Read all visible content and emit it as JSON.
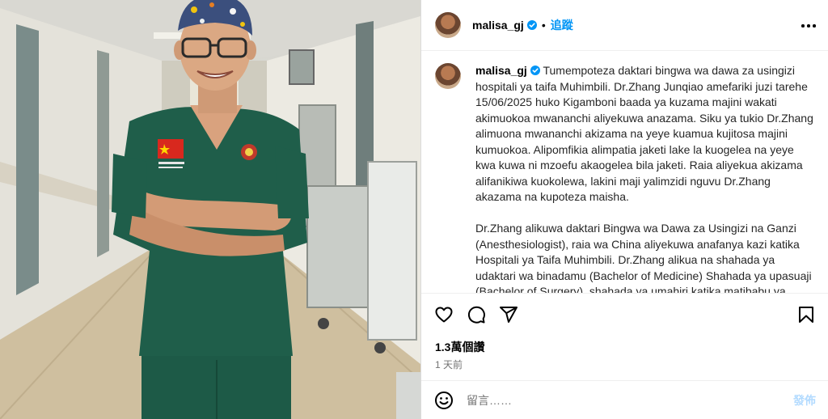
{
  "post": {
    "username": "malisa_gj",
    "separator": "•",
    "follow_label": "追蹤",
    "caption_para1": "Tumempoteza daktari bingwa wa dawa za usingizi hospitali ya taifa Muhimbili. Dr.Zhang Junqiao amefariki juzi tarehe 15/06/2025 huko Kigamboni baada ya kuzama majini wakati akimuokoa mwananchi aliyekuwa anazama. Siku ya tukio Dr.Zhang alimuona mwananchi akizama na yeye kuamua kujitosa majini kumuokoa. Alipomfikia alimpatia jaketi lake la kuogelea na yeye kwa kuwa ni mzoefu akaogelea bila jaketi. Raia aliyekua akizama alifanikiwa kuokolewa, lakini maji yalimzidi nguvu Dr.Zhang akazama na kupoteza maisha.",
    "caption_para2": "Dr.Zhang alikuwa daktari Bingwa wa Dawa za Usingizi na Ganzi (Anesthesiologist), raia wa China aliyekuwa anafanya kazi katika Hospitali ya Taifa Muhimbili. Dr.Zhang alikua na shahada ya udaktari wa binadamu (Bachelor of Medicine) Shahada ya upasuaji (Bachelor of Surgery), shahada ya umahiri katika matibabu ya ndani (Master of Internal Medicine) na shahada ya",
    "likes": "1.3萬個讚",
    "time": "1 天前",
    "comment_placeholder": "留言……",
    "post_label": "發佈"
  },
  "icons": {
    "like": "heart-icon",
    "comment": "comment-icon",
    "share": "share-icon",
    "save": "bookmark-icon",
    "emoji": "emoji-icon",
    "verified": "verified-badge-icon",
    "more": "more-options-icon"
  },
  "colors": {
    "accent": "#0095f6",
    "verified": "#0095f6",
    "scrubs": "#1f5e4a",
    "cap": "#3a4d7a"
  }
}
